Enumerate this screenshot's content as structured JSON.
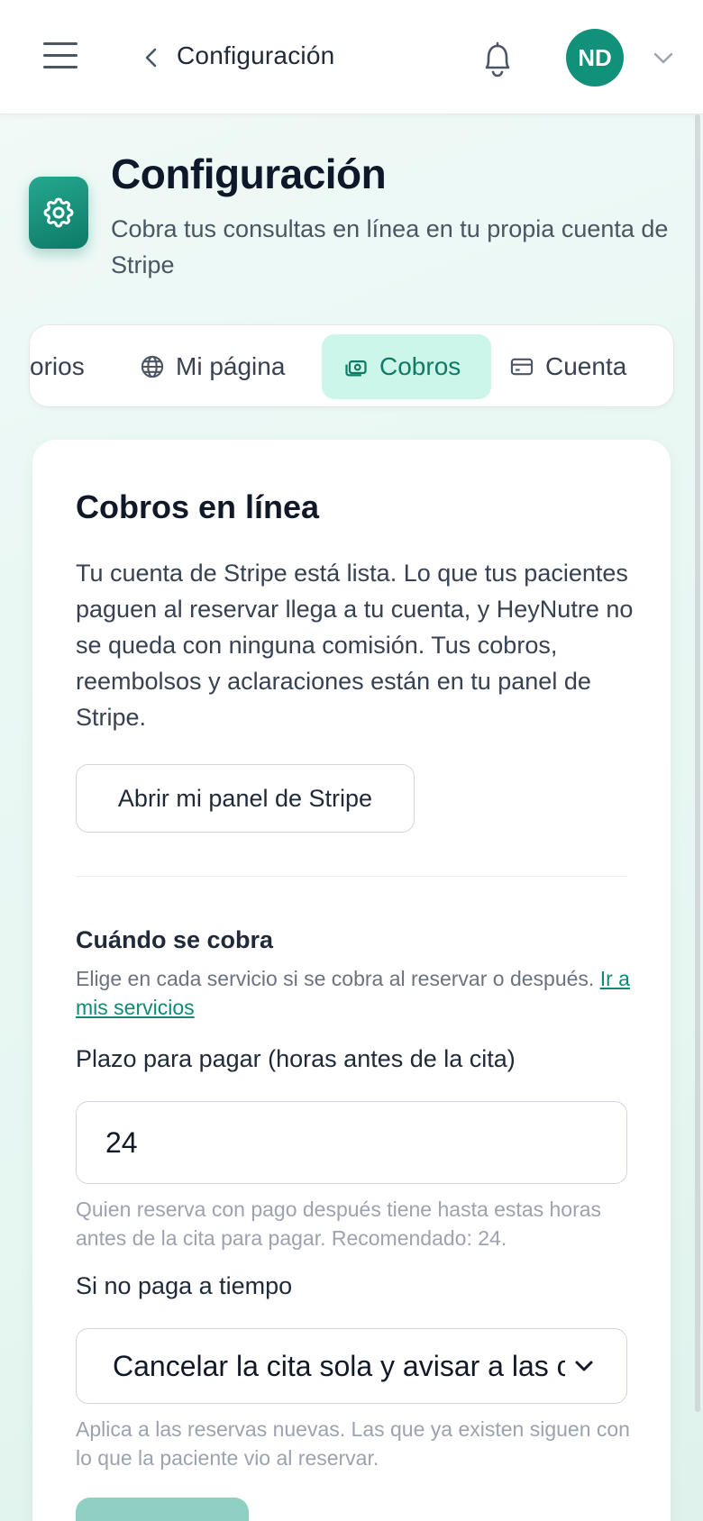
{
  "header": {
    "title": "Configuración",
    "avatar_initials": "ND",
    "colors": {
      "accent": "#11907a",
      "tab_active_bg": "#ccf6ea"
    }
  },
  "page": {
    "title": "Configuración",
    "subtitle": "Cobra tus consultas en línea en tu propia cuenta de Stripe"
  },
  "tabs": [
    {
      "label": "orios",
      "icon": "truncated-tab"
    },
    {
      "label": "Mi página",
      "icon": "globe-icon"
    },
    {
      "label": "Cobros",
      "icon": "money-icon",
      "active": true
    },
    {
      "label": "Cuenta",
      "icon": "credit-card-icon"
    }
  ],
  "card": {
    "title": "Cobros en línea",
    "description": "Tu cuenta de Stripe está lista. Lo que tus pacientes paguen al reservar llega a tu cuenta, y HeyNutre no se queda con ninguna comisión. Tus cobros, reembolsos y aclaraciones están en tu panel de Stripe.",
    "stripe_button": "Abrir mi panel de Stripe",
    "when_section": {
      "title": "Cuándo se cobra",
      "help": "Elige en cada servicio si se cobra al reservar o después.",
      "link": "Ir a mis servicios"
    },
    "deadline": {
      "label": "Plazo para pagar (horas antes de la cita)",
      "value": "24",
      "help": "Quien reserva con pago después tiene hasta estas horas antes de la cita para pagar. Recomendado: 24."
    },
    "late_payment": {
      "label": "Si no paga a tiempo",
      "selected": "Cancelar la cita sola y avisar a las c",
      "help": "Aplica a las reservas nuevas. Las que ya existen siguen con lo que la paciente vio al reservar."
    }
  }
}
